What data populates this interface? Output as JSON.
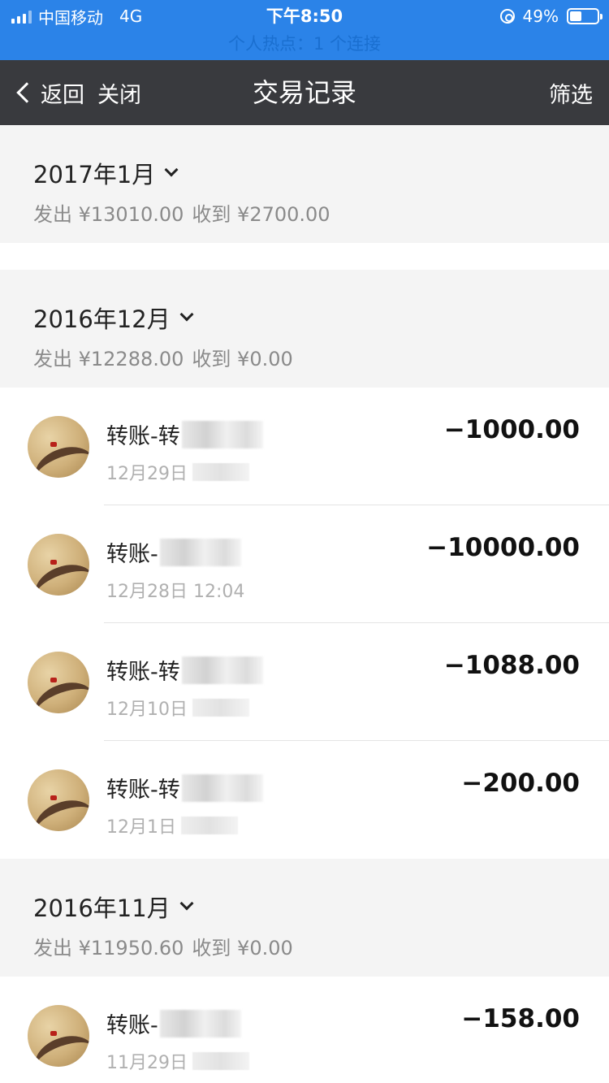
{
  "status_bar": {
    "carrier": "中国移动",
    "network": "4G",
    "time": "下午8:50",
    "battery": "49%",
    "battery_level": 0.49,
    "hotspot": "个人热点：1 个连接"
  },
  "nav": {
    "back_label": "返回",
    "close_label": "关闭",
    "title": "交易记录",
    "filter_label": "筛选"
  },
  "months": [
    {
      "title": "2017年1月",
      "sent": "发出 ¥13010.00",
      "received": "收到 ¥2700.00",
      "transactions": []
    },
    {
      "title": "2016年12月",
      "sent": "发出 ¥12288.00",
      "received": "收到 ¥0.00",
      "transactions": [
        {
          "title": "转账-转",
          "time": "12月29日",
          "amount": "−1000.00"
        },
        {
          "title": "转账-",
          "time": "12月28日 12:04",
          "amount": "−10000.00"
        },
        {
          "title": "转账-转",
          "time": "12月10日",
          "amount": "−1088.00"
        },
        {
          "title": "转账-转",
          "time": "12月1日",
          "amount": "−200.00"
        }
      ]
    },
    {
      "title": "2016年11月",
      "sent": "发出 ¥11950.60",
      "received": "收到 ¥0.00",
      "transactions": [
        {
          "title": "转账-",
          "time": "11月29日",
          "amount": "−158.00"
        }
      ]
    }
  ]
}
